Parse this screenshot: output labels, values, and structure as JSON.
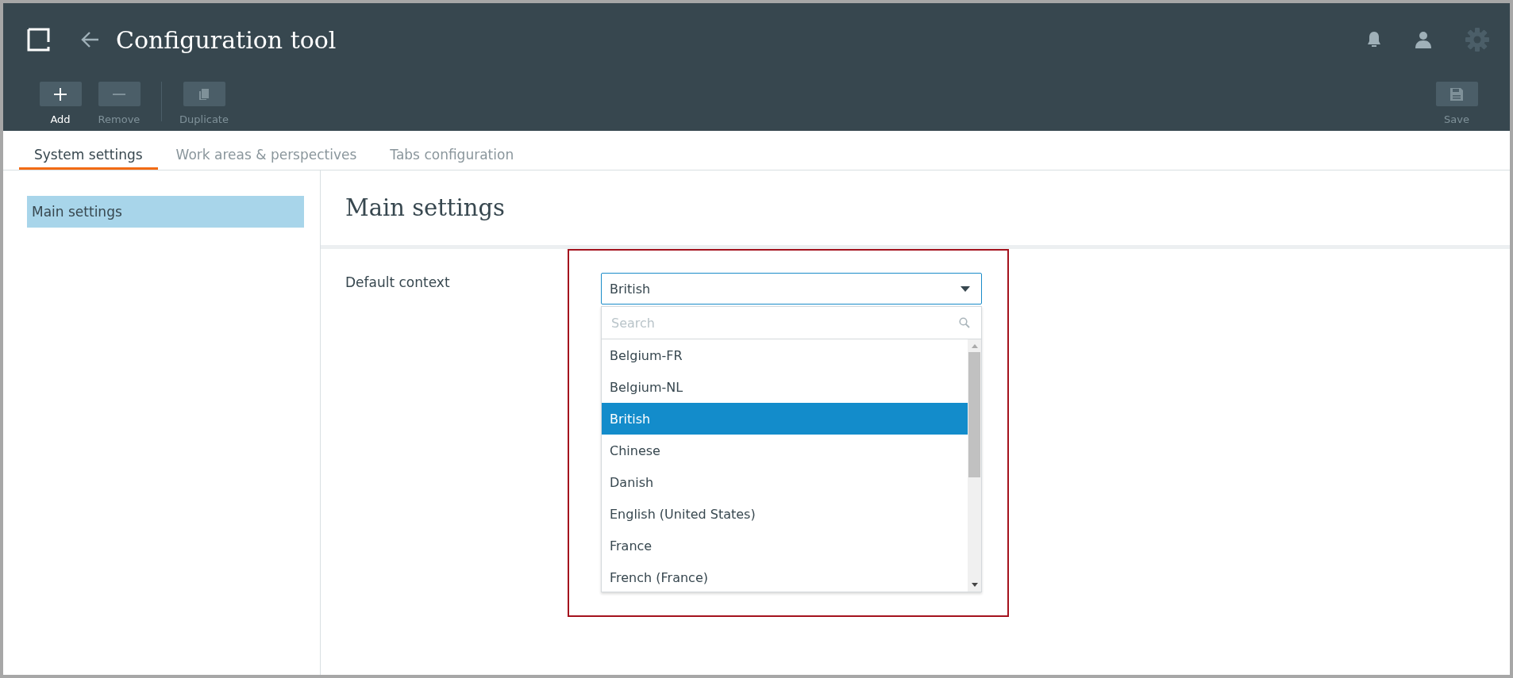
{
  "window": {
    "title": "Configuration tool"
  },
  "toolbar": [
    {
      "label": "Add",
      "kind": "add",
      "disabled": false
    },
    {
      "label": "Remove",
      "kind": "remove",
      "disabled": true
    },
    {
      "label": "Duplicate",
      "kind": "duplicate",
      "disabled": true
    }
  ],
  "save_button": {
    "label": "Save",
    "disabled": true
  },
  "tabs": [
    {
      "label": "System settings",
      "selected": true
    },
    {
      "label": "Work areas & perspectives",
      "selected": false
    },
    {
      "label": "Tabs configuration",
      "selected": false
    }
  ],
  "sidebar": {
    "items": [
      {
        "label": "Main settings",
        "selected": true
      }
    ]
  },
  "main": {
    "heading": "Main settings",
    "field": {
      "label": "Default context",
      "value": "British",
      "dropdown": {
        "search_placeholder": "Search",
        "options": [
          {
            "label": "Belgium-FR",
            "selected": false
          },
          {
            "label": "Belgium-NL",
            "selected": false
          },
          {
            "label": "British",
            "selected": true
          },
          {
            "label": "Chinese",
            "selected": false
          },
          {
            "label": "Danish",
            "selected": false
          },
          {
            "label": "English (United States)",
            "selected": false
          },
          {
            "label": "France",
            "selected": false
          },
          {
            "label": "French (France)",
            "selected": false
          }
        ]
      }
    }
  }
}
